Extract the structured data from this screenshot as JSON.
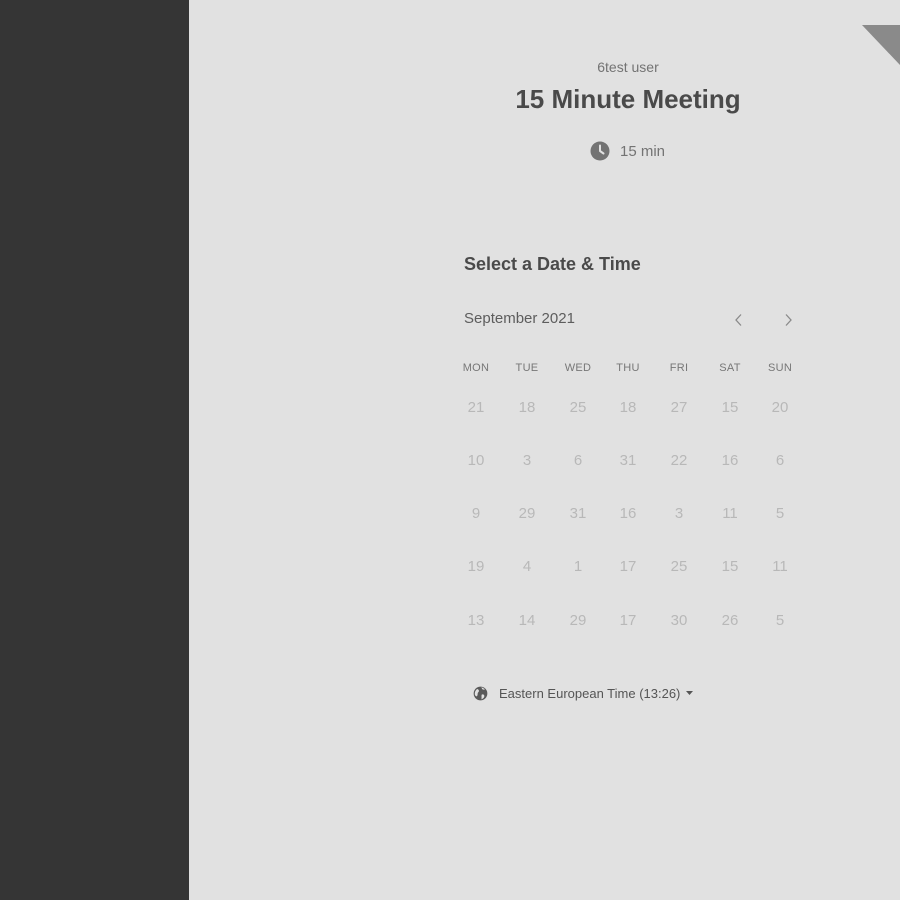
{
  "colors": {
    "left_panel": "#353535",
    "page_bg": "#e1e1e1",
    "ribbon": "#8a8a8a",
    "muted_text": "#737373",
    "title_text": "#4a4a4a",
    "disabled_day": "#b8b8b8"
  },
  "host": {
    "name": "6test user"
  },
  "event": {
    "title": "15 Minute Meeting",
    "duration_icon": "clock-icon",
    "duration_label": "15 min"
  },
  "scheduler": {
    "section_title": "Select a Date & Time",
    "month_label": "September 2021",
    "prev_icon": "chevron-left-icon",
    "next_icon": "chevron-right-icon",
    "weekdays": [
      "MON",
      "TUE",
      "WED",
      "THU",
      "FRI",
      "SAT",
      "SUN"
    ],
    "weeks": [
      [
        "21",
        "18",
        "25",
        "18",
        "27",
        "15",
        "20"
      ],
      [
        "10",
        "3",
        "6",
        "31",
        "22",
        "16",
        "6"
      ],
      [
        "9",
        "29",
        "31",
        "16",
        "3",
        "11",
        "5"
      ],
      [
        "19",
        "4",
        "1",
        "17",
        "25",
        "15",
        "11"
      ],
      [
        "13",
        "14",
        "29",
        "17",
        "30",
        "26",
        "5"
      ]
    ]
  },
  "timezone": {
    "icon": "globe-icon",
    "label": "Eastern European Time (13:26)",
    "caret_icon": "caret-down-icon"
  }
}
